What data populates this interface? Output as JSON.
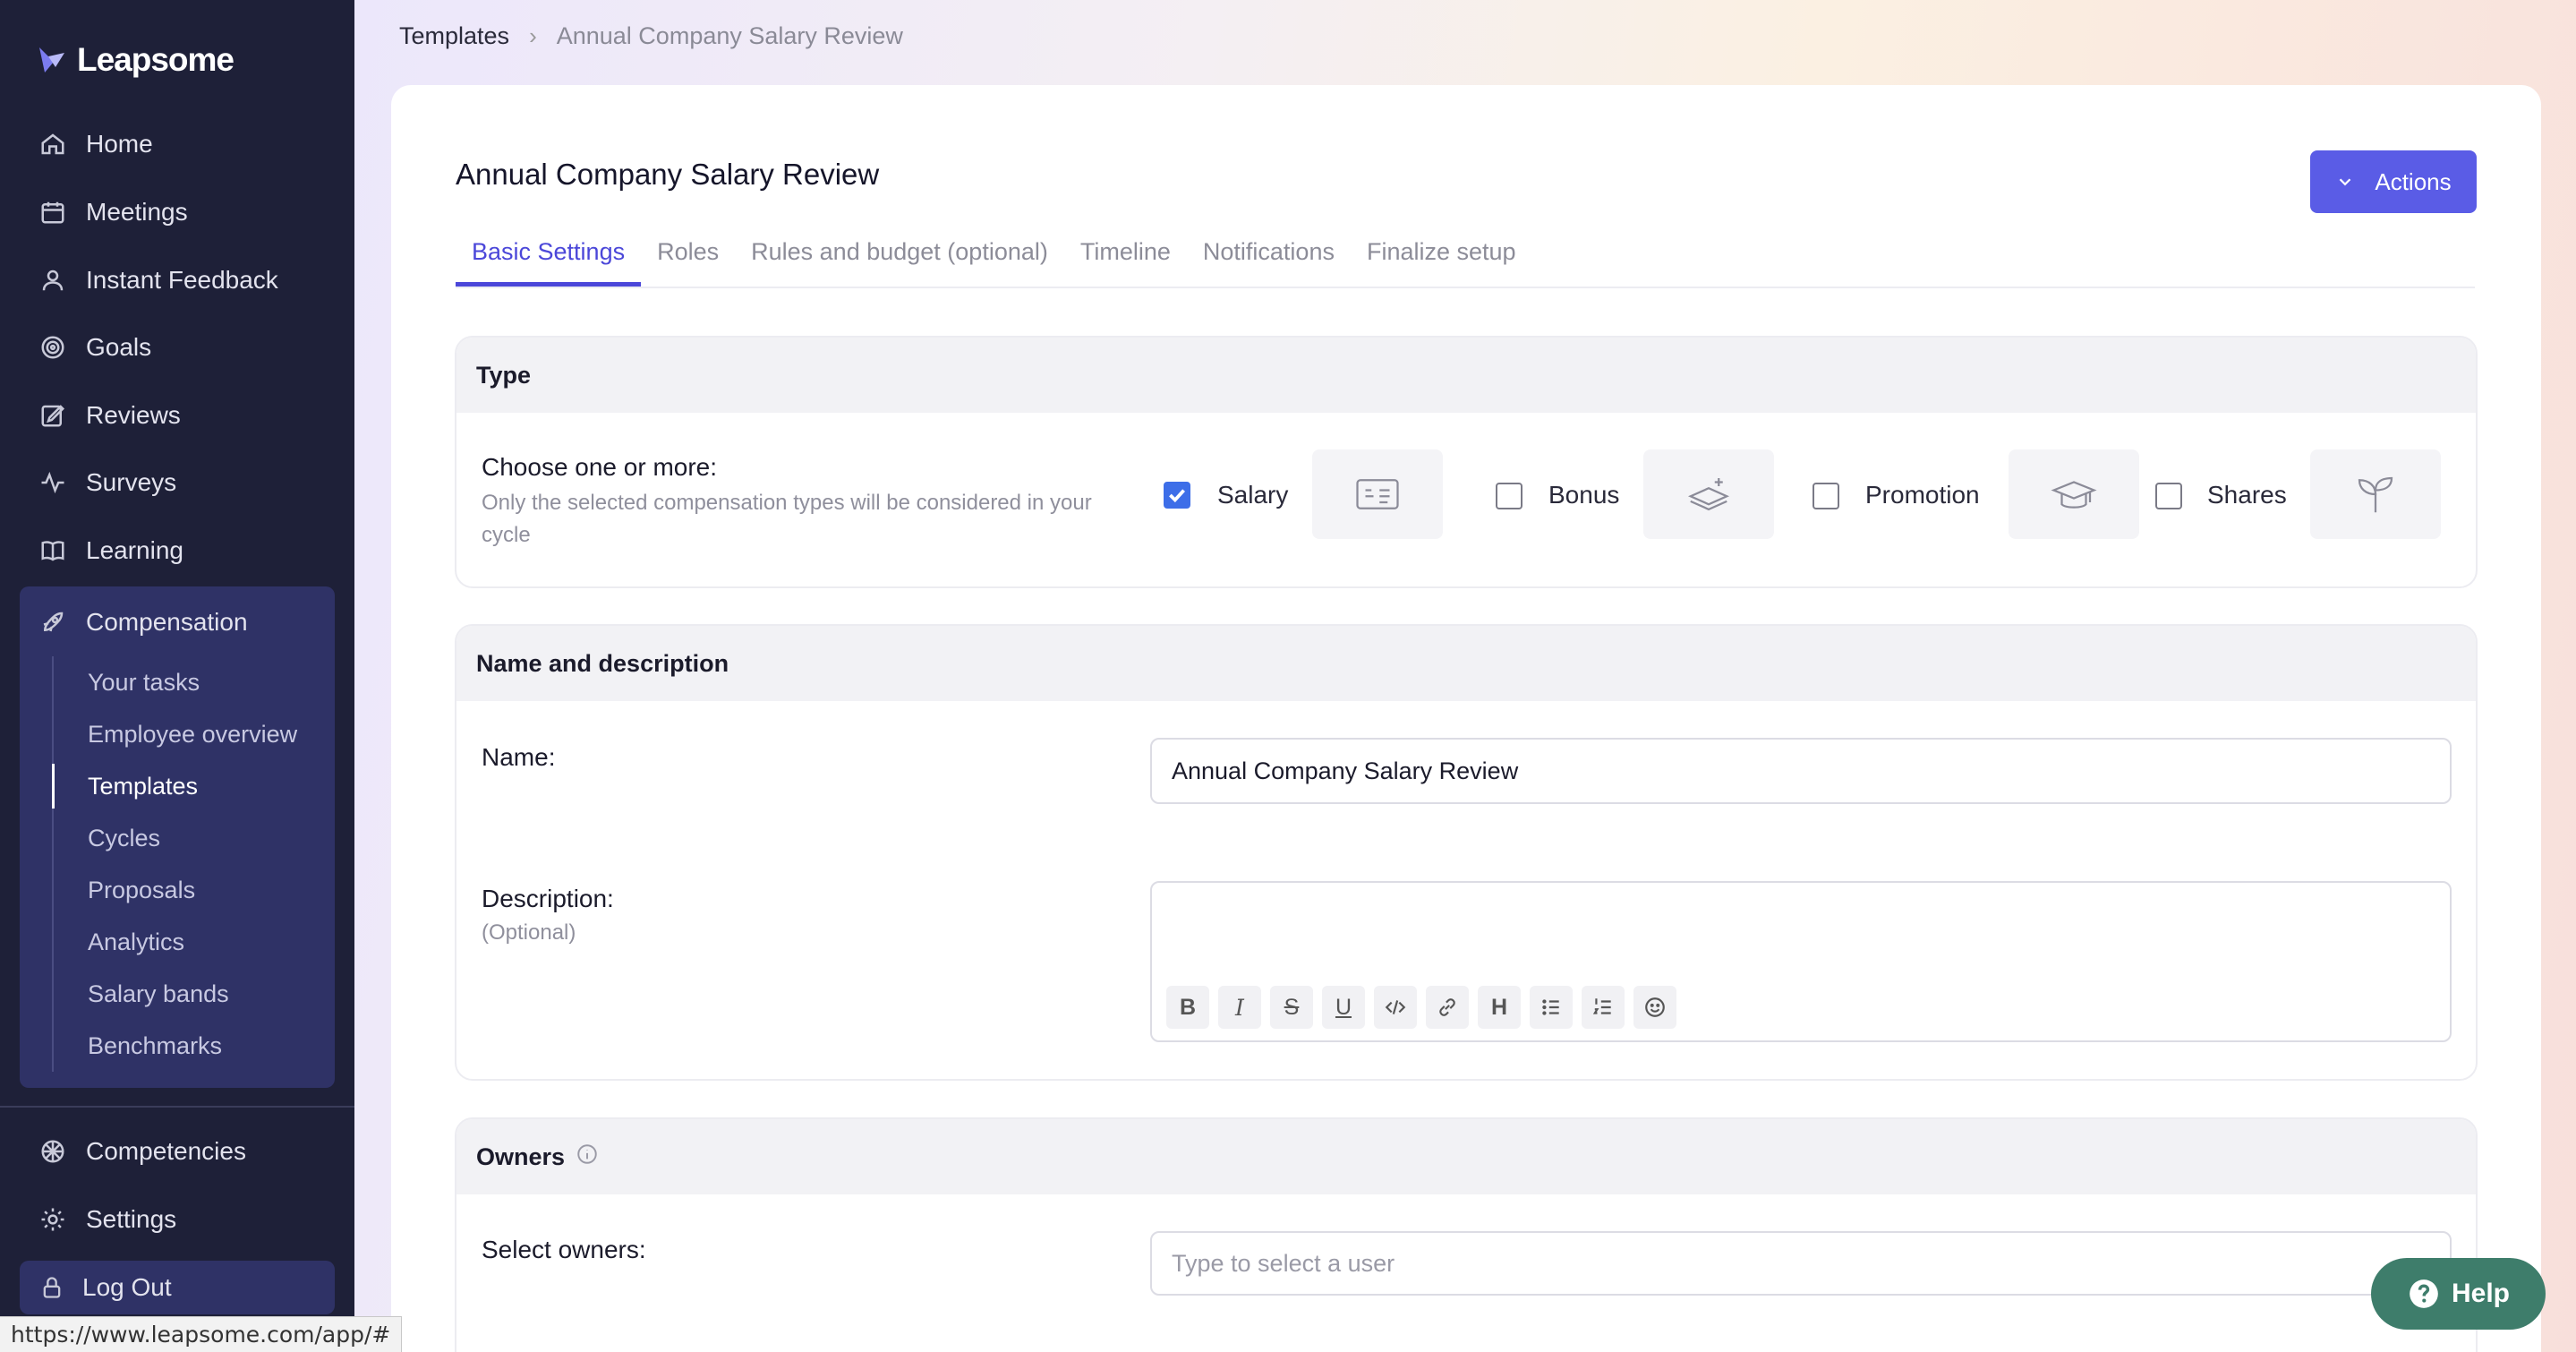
{
  "app": {
    "logo_text": "Leapsome"
  },
  "sidebar": {
    "items": [
      {
        "label": "Home",
        "icon": "home-icon"
      },
      {
        "label": "Meetings",
        "icon": "meetings-icon"
      },
      {
        "label": "Instant Feedback",
        "icon": "feedback-icon"
      },
      {
        "label": "Goals",
        "icon": "goals-icon"
      },
      {
        "label": "Reviews",
        "icon": "reviews-icon"
      },
      {
        "label": "Surveys",
        "icon": "surveys-icon"
      },
      {
        "label": "Learning",
        "icon": "learning-icon"
      }
    ],
    "compensation": {
      "label": "Compensation",
      "icon": "rocket-icon",
      "subitems": [
        "Your tasks",
        "Employee overview",
        "Templates",
        "Cycles",
        "Proposals",
        "Analytics",
        "Salary bands",
        "Benchmarks"
      ],
      "active": "Templates"
    },
    "bottom_items": [
      {
        "label": "Competencies",
        "icon": "competencies-icon"
      },
      {
        "label": "Settings",
        "icon": "gear-icon"
      }
    ],
    "logout_label": "Log Out"
  },
  "status_bar": {
    "url": "https://www.leapsome.com/app/#"
  },
  "breadcrumb": {
    "parent": "Templates",
    "current": "Annual Company Salary Review"
  },
  "page": {
    "title": "Annual Company Salary Review",
    "actions_label": "Actions"
  },
  "tabs": [
    {
      "label": "Basic Settings",
      "active": true
    },
    {
      "label": "Roles",
      "active": false
    },
    {
      "label": "Rules and budget (optional)",
      "active": false
    },
    {
      "label": "Timeline",
      "active": false
    },
    {
      "label": "Notifications",
      "active": false
    },
    {
      "label": "Finalize setup",
      "active": false
    }
  ],
  "type_section": {
    "title": "Type",
    "choose_label": "Choose one or more:",
    "help_text": "Only the selected compensation types will be considered in your cycle",
    "options": [
      {
        "label": "Salary",
        "checked": true,
        "icon": "salary-icon"
      },
      {
        "label": "Bonus",
        "checked": false,
        "icon": "bonus-icon"
      },
      {
        "label": "Promotion",
        "checked": false,
        "icon": "graduation-cap-icon"
      },
      {
        "label": "Shares",
        "checked": false,
        "icon": "sprout-icon"
      }
    ]
  },
  "name_section": {
    "title": "Name and description",
    "name_label": "Name:",
    "name_value": "Annual Company Salary Review",
    "description_label": "Description:",
    "description_optional": "(Optional)"
  },
  "owners_section": {
    "title": "Owners",
    "select_label": "Select owners:",
    "select_placeholder": "Type to select a user"
  },
  "help": {
    "label": "Help"
  },
  "colors": {
    "sidebar_bg": "#1e2038",
    "accent": "#5a5ce6",
    "tab_active": "#4b47d9",
    "help_bg": "#3e7d6b"
  }
}
